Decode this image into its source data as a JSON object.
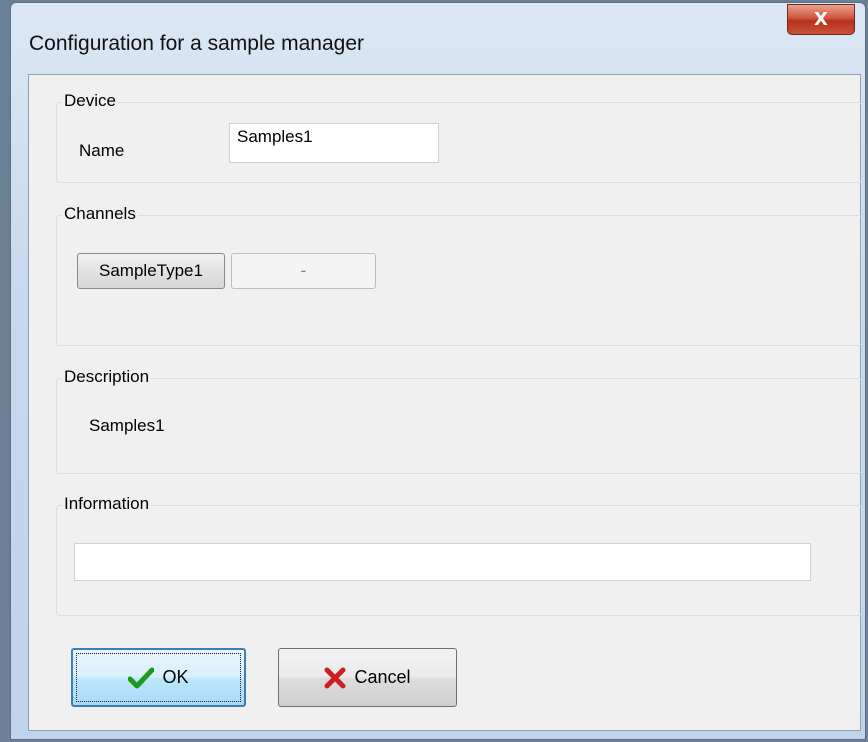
{
  "window": {
    "title": "Configuration for a sample manager",
    "close_glyph": "X"
  },
  "device": {
    "group_label": "Device",
    "name_label": "Name",
    "name_value": "Samples1"
  },
  "channels": {
    "group_label": "Channels",
    "buttons": [
      {
        "label": "SampleType1",
        "enabled": true
      },
      {
        "label": "-",
        "enabled": false
      }
    ]
  },
  "description": {
    "group_label": "Description",
    "text": "Samples1"
  },
  "information": {
    "group_label": "Information",
    "value": ""
  },
  "buttons": {
    "ok_label": "OK",
    "cancel_label": "Cancel"
  },
  "colors": {
    "ok_check": "#1e9a1e",
    "cancel_x": "#cc1f1f",
    "close_button": "#c8533a"
  },
  "icons": {
    "ok": "checkmark-icon",
    "cancel": "red-x-icon",
    "close": "close-icon"
  }
}
